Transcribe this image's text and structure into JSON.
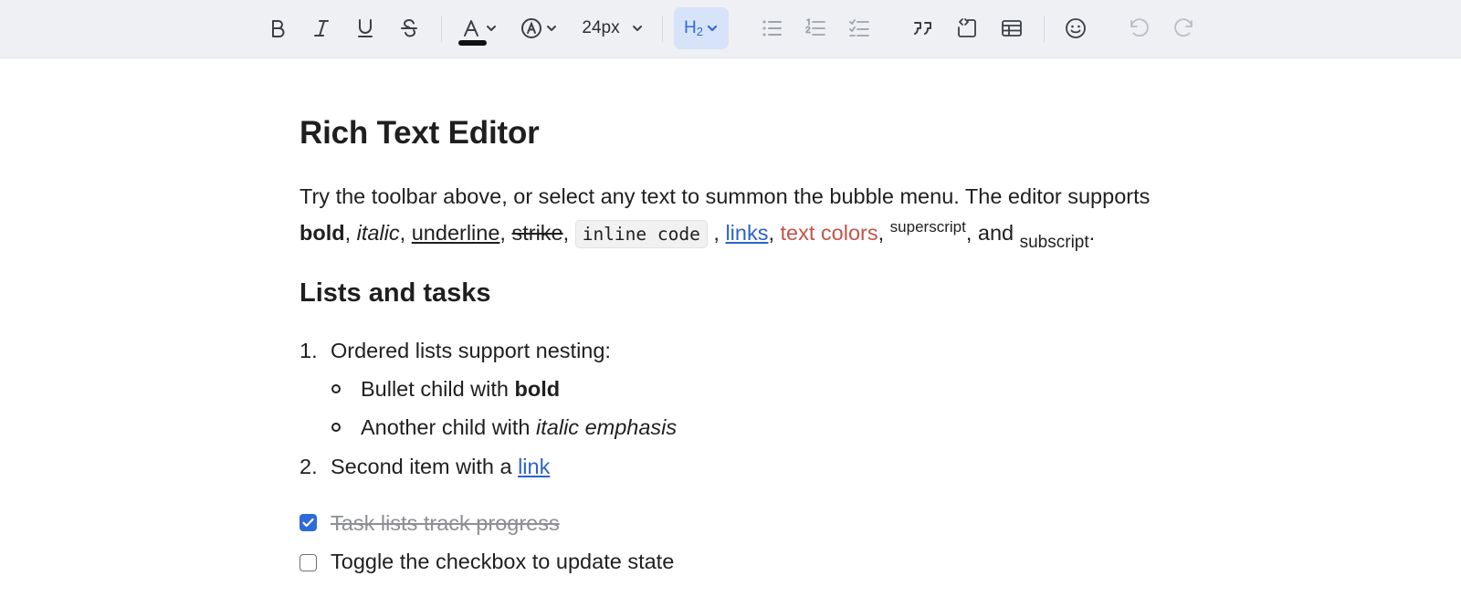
{
  "toolbar": {
    "buttons": [
      {
        "name": "bold-button",
        "icon": "bold-icon",
        "state": "enabled"
      },
      {
        "name": "italic-button",
        "icon": "italic-icon",
        "state": "enabled"
      },
      {
        "name": "underline-button",
        "icon": "underline-icon",
        "state": "enabled"
      },
      {
        "name": "strikethrough-button",
        "icon": "strikethrough-icon",
        "state": "enabled"
      },
      {
        "name": "text-color-button",
        "icon": "text-color-icon",
        "state": "enabled"
      },
      {
        "name": "highlight-button",
        "icon": "highlight-icon",
        "state": "enabled"
      },
      {
        "name": "bullet-list-button",
        "icon": "bullet-list-icon",
        "state": "muted"
      },
      {
        "name": "ordered-list-button",
        "icon": "ordered-list-icon",
        "state": "muted"
      },
      {
        "name": "task-list-button",
        "icon": "task-list-icon",
        "state": "muted"
      },
      {
        "name": "blockquote-button",
        "icon": "quote-icon",
        "state": "enabled"
      },
      {
        "name": "code-block-button",
        "icon": "code-block-icon",
        "state": "enabled"
      },
      {
        "name": "table-button",
        "icon": "table-icon",
        "state": "enabled"
      },
      {
        "name": "emoji-button",
        "icon": "smiley-icon",
        "state": "enabled"
      },
      {
        "name": "undo-button",
        "icon": "undo-icon",
        "state": "disabled"
      },
      {
        "name": "redo-button",
        "icon": "redo-icon",
        "state": "disabled"
      }
    ],
    "text_color": "#111111",
    "font_size": "24px",
    "heading": {
      "label": "H",
      "level": "2",
      "active": true
    }
  },
  "colors": {
    "toolbar_bg": "#eef0f4",
    "accent": "#2f6bd8",
    "link": "#2b63c8",
    "red_text": "#c25449",
    "done_text": "#8d8f93"
  },
  "doc": {
    "title": "Rich Text Editor",
    "intro": {
      "lead": "Try the toolbar above, or select any text to summon the bubble menu. The editor supports",
      "bold": "bold",
      "italic": "italic",
      "underline": "underline",
      "strike": "strike",
      "code": "inline code",
      "link": "links",
      "colored": "text colors",
      "superscript": "superscript",
      "and": ", and ",
      "subscript": "subscript",
      "end": "."
    },
    "section_heading": "Lists and tasks",
    "ordered_list": [
      {
        "number": "1.",
        "text": "Ordered lists support nesting:",
        "children": [
          {
            "text": "Bullet child with ",
            "emphasis": "bold"
          },
          {
            "text": "Another child with ",
            "emphasis": "italic emphasis"
          }
        ]
      },
      {
        "number": "2.",
        "text": "Second item with a ",
        "link": "link"
      }
    ],
    "tasks": [
      {
        "text": "Task lists track progress",
        "checked": true
      },
      {
        "text": "Toggle the checkbox to update state",
        "checked": false
      }
    ]
  }
}
